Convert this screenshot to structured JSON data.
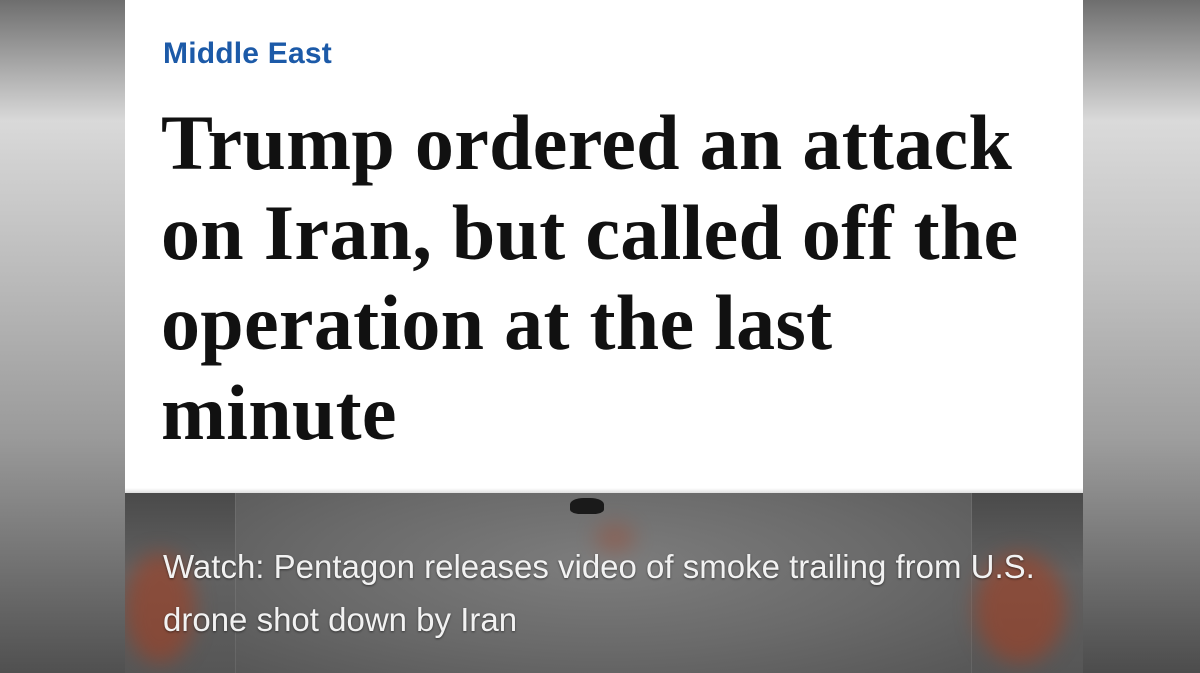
{
  "article": {
    "section": "Middle East",
    "headline": "Trump ordered an attack on Iran, but called off the operation at the last minute"
  },
  "video": {
    "caption": "Watch: Pentagon releases video of smoke trailing from U.S. drone shot down by Iran"
  },
  "colors": {
    "section_accent": "#1c5aa8",
    "headline_text": "#111111",
    "card_background": "#ffffff",
    "caption_text": "#f2f2f2"
  }
}
